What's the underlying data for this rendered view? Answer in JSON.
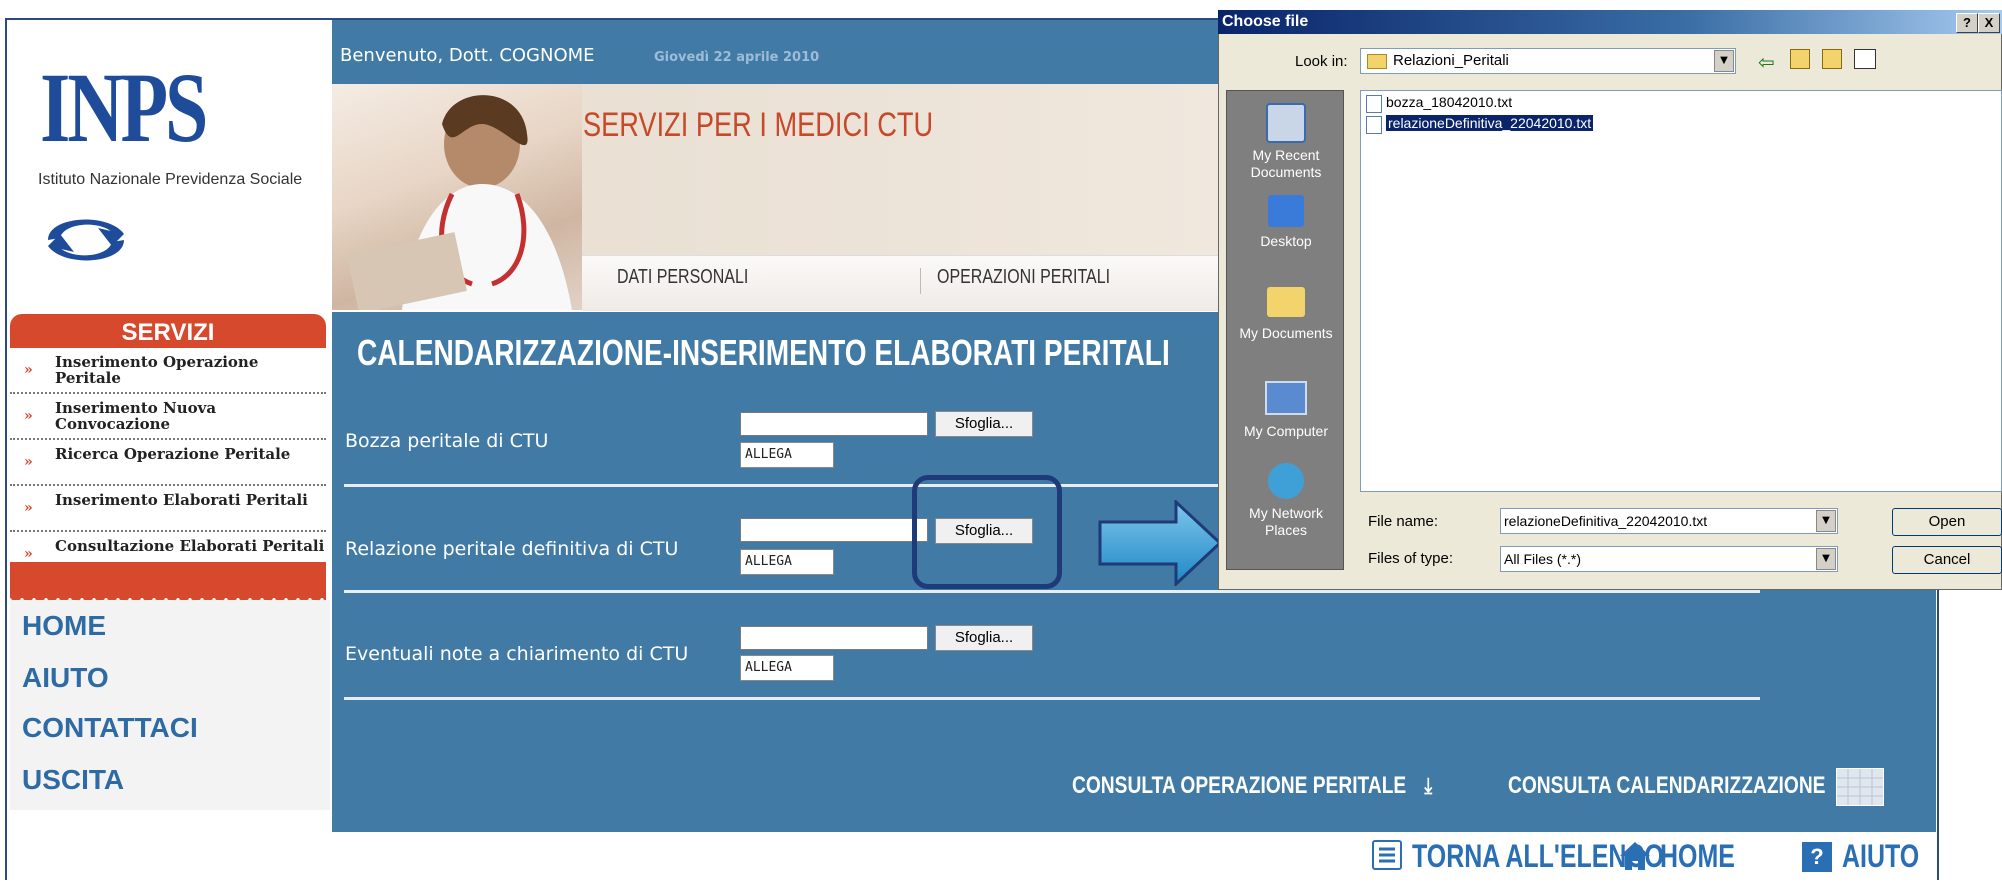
{
  "app": {
    "logo_text": "INPS",
    "logo_subtitle": "Istituto Nazionale Previdenza Sociale",
    "welcome": "Benvenuto, Dott. COGNOME",
    "date": "Giovedì 22 aprile 2010",
    "banner_title": "SERVIZI PER I MEDICI CTU"
  },
  "tabs": [
    {
      "label": "DATI PERSONALI"
    },
    {
      "label": "OPERAZIONI PERITALI"
    }
  ],
  "sidebar": {
    "header": "SERVIZI",
    "items": [
      {
        "label": "Inserimento Operazione Peritale"
      },
      {
        "label": "Inserimento Nuova Convocazione"
      },
      {
        "label": "Ricerca Operazione Peritale"
      },
      {
        "label": "Inserimento Elaborati Peritali"
      },
      {
        "label": "Consultazione Elaborati Peritali"
      }
    ],
    "bullet": "»",
    "nav": [
      {
        "label": "HOME"
      },
      {
        "label": "AIUTO"
      },
      {
        "label": "CONTATTACI"
      },
      {
        "label": "USCITA"
      }
    ]
  },
  "main": {
    "title": "CALENDARIZZAZIONE-INSERIMENTO ELABORATI PERITALI",
    "browse_label": "Sfoglia...",
    "attach_label": "ALLEGA",
    "rows": [
      {
        "label": "Bozza peritale di CTU",
        "file_value": ""
      },
      {
        "label": "Relazione peritale definitiva di CTU",
        "file_value": ""
      },
      {
        "label": "Eventuali note a chiarimento di CTU",
        "file_value": ""
      }
    ],
    "links": {
      "consulta_operazione": "CONSULTA OPERAZIONE PERITALE",
      "consulta_calendarizzazione": "CONSULTA CALENDARIZZAZIONE"
    }
  },
  "bottom_links": {
    "torna": "TORNA ALL'ELENCO",
    "home": "HOME",
    "aiuto": "AIUTO"
  },
  "dialog": {
    "title": "Choose file",
    "help_btn": "?",
    "close_btn": "X",
    "look_in_label": "Look in:",
    "look_in_value": "Relazioni_Peritali",
    "places": [
      {
        "label": "My Recent Documents"
      },
      {
        "label": "Desktop"
      },
      {
        "label": "My Documents"
      },
      {
        "label": "My Computer"
      },
      {
        "label": "My Network Places"
      }
    ],
    "files": [
      {
        "name": "bozza_18042010.txt",
        "selected": false
      },
      {
        "name": "relazioneDefinitiva_22042010.txt",
        "selected": true
      }
    ],
    "file_name_label": "File name:",
    "file_name_value": "relazioneDefinitiva_22042010.txt",
    "file_type_label": "Files of type:",
    "file_type_value": "All Files (*.*)",
    "open_label": "Open",
    "cancel_label": "Cancel"
  },
  "colors": {
    "inps_blue": "#1e4c9a",
    "panel_blue": "#417ba5",
    "servizi_red": "#d6492c",
    "link_blue": "#2a6fb3",
    "highlight_navy": "#1f3a78"
  }
}
